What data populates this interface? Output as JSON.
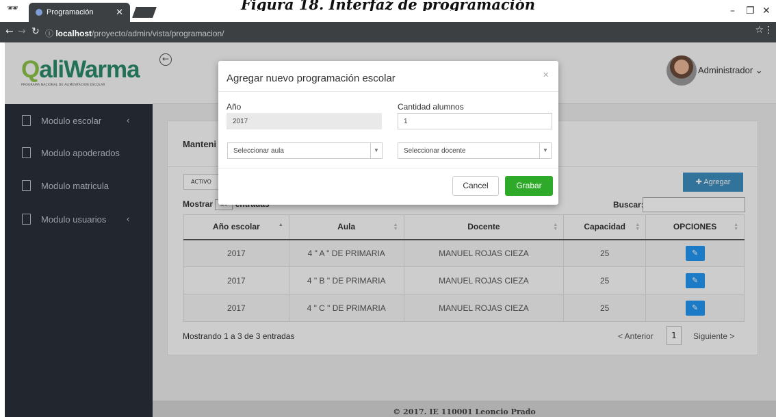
{
  "caption": "Figura 18. Interfaz de programación",
  "browser": {
    "tab_title": "Programación",
    "url_host": "localhost",
    "url_path": "/proyecto/admin/vista/programacion/"
  },
  "app": {
    "logo": {
      "name_prefix": "Q",
      "name_rest": "aliWarma",
      "tagline": "PROGRAMA NACIONAL DE ALIMENTACION ESCOLAR"
    },
    "user_label": "Administrador ⌄",
    "sidebar": {
      "items": [
        {
          "label": "Modulo escolar",
          "has_submenu": true
        },
        {
          "label": "Modulo apoderados",
          "has_submenu": false
        },
        {
          "label": "Modulo matricula",
          "has_submenu": false
        },
        {
          "label": "Modulo usuarios",
          "has_submenu": true
        }
      ]
    },
    "panel": {
      "title": "Manteni",
      "activo_label": "ACTIVO",
      "agregar_label": "✚ Agregar",
      "mostrar_label": "Mostrar",
      "mostrar_value": "10",
      "entradas_label": "entradas",
      "buscar_label": "Buscar:",
      "table": {
        "columns": [
          "Año escolar",
          "Aula",
          "Docente",
          "Capacidad",
          "OPCIONES"
        ],
        "rows": [
          {
            "anio": "2017",
            "aula": "4 \" A \" DE PRIMARIA",
            "docente": "MANUEL ROJAS CIEZA",
            "capacidad": "25"
          },
          {
            "anio": "2017",
            "aula": "4 \" B \" DE PRIMARIA",
            "docente": "MANUEL ROJAS CIEZA",
            "capacidad": "25"
          },
          {
            "anio": "2017",
            "aula": "4 \" C \" DE PRIMARIA",
            "docente": "MANUEL ROJAS CIEZA",
            "capacidad": "25"
          }
        ]
      },
      "info": "Mostrando 1 a 3 de 3 entradas",
      "pagination": {
        "prev": "< Anterior",
        "page": "1",
        "next": "Siguiente >"
      }
    },
    "footer": "© 2017. IE 110001 Leoncio Prado"
  },
  "modal": {
    "title": "Agregar nuevo programación escolar",
    "year_label": "Año",
    "year_value": "2017",
    "students_label": "Cantidad alumnos",
    "students_value": "1",
    "aula_placeholder": "Seleccionar aula",
    "docente_placeholder": "Seleccionar docente",
    "cancel_label": "Cancel",
    "save_label": "Grabar"
  },
  "colors": {
    "sidebar": "#2a2f3a",
    "primary": "#3c8dbc",
    "success": "#2fa92a",
    "edit": "#2196f3"
  }
}
